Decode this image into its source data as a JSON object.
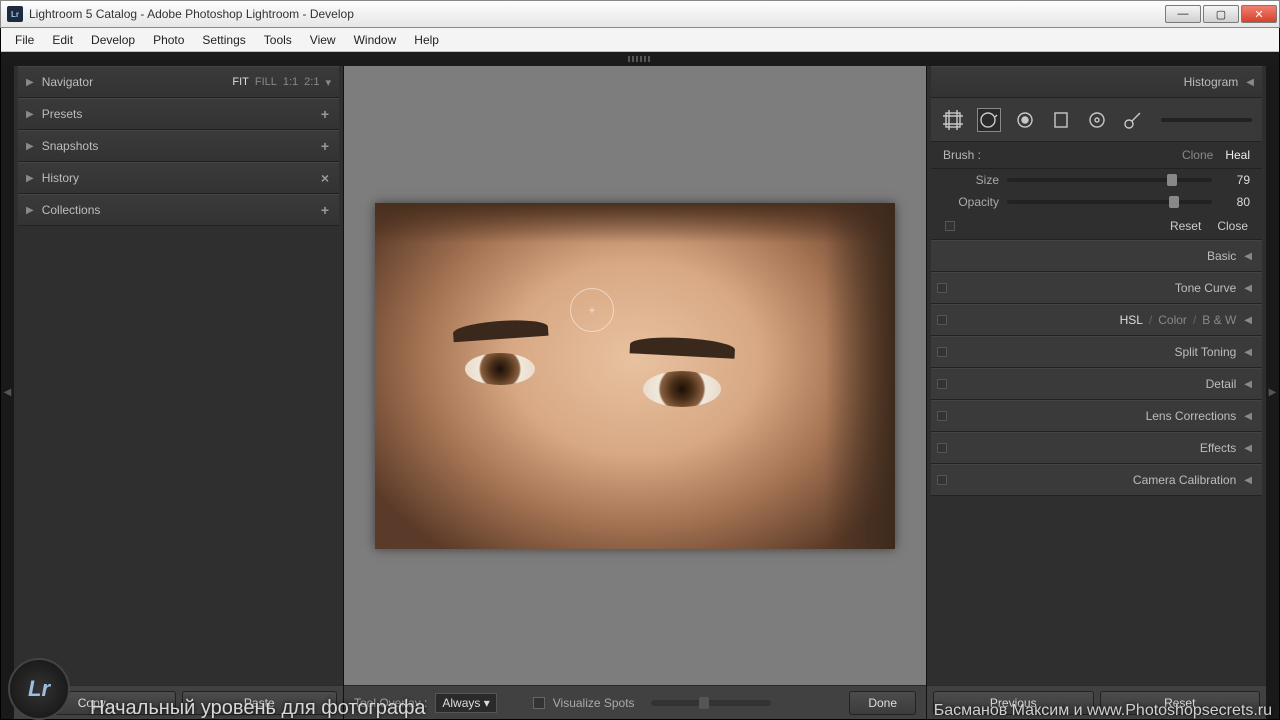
{
  "window": {
    "title": "Lightroom 5 Catalog - Adobe Photoshop Lightroom - Develop",
    "appicon_text": "Lr"
  },
  "menus": [
    "File",
    "Edit",
    "Develop",
    "Photo",
    "Settings",
    "Tools",
    "View",
    "Window",
    "Help"
  ],
  "left_panels": {
    "navigator": {
      "label": "Navigator",
      "zoom": [
        "FIT",
        "FILL",
        "1:1",
        "2:1"
      ],
      "active_zoom": "FIT"
    },
    "items": [
      {
        "label": "Presets",
        "action": "+"
      },
      {
        "label": "Snapshots",
        "action": "+"
      },
      {
        "label": "History",
        "action": "×"
      },
      {
        "label": "Collections",
        "action": "+"
      }
    ]
  },
  "left_foot": {
    "copy": "Copy…",
    "paste": "Paste"
  },
  "center_toolbar": {
    "tool_overlay_label": "Tool Overlay :",
    "tool_overlay_value": "Always",
    "visualize_spots": "Visualize Spots",
    "done": "Done"
  },
  "right": {
    "histogram": "Histogram",
    "brush_label": "Brush :",
    "clone": "Clone",
    "heal": "Heal",
    "size_label": "Size",
    "size_value": "79",
    "opacity_label": "Opacity",
    "opacity_value": "80",
    "reset": "Reset",
    "close": "Close",
    "panels": [
      "Basic",
      "Tone Curve",
      "HSL",
      "Color",
      "B & W",
      "Split Toning",
      "Detail",
      "Lens Corrections",
      "Effects",
      "Camera Calibration"
    ]
  },
  "right_foot": {
    "previous": "Previous",
    "reset": "Reset"
  },
  "overlay": {
    "caption": "Начальный уровень для фотографа",
    "credit": "Басманов Максим и www.Photoshopsecrets.ru",
    "badge": "Lr"
  }
}
